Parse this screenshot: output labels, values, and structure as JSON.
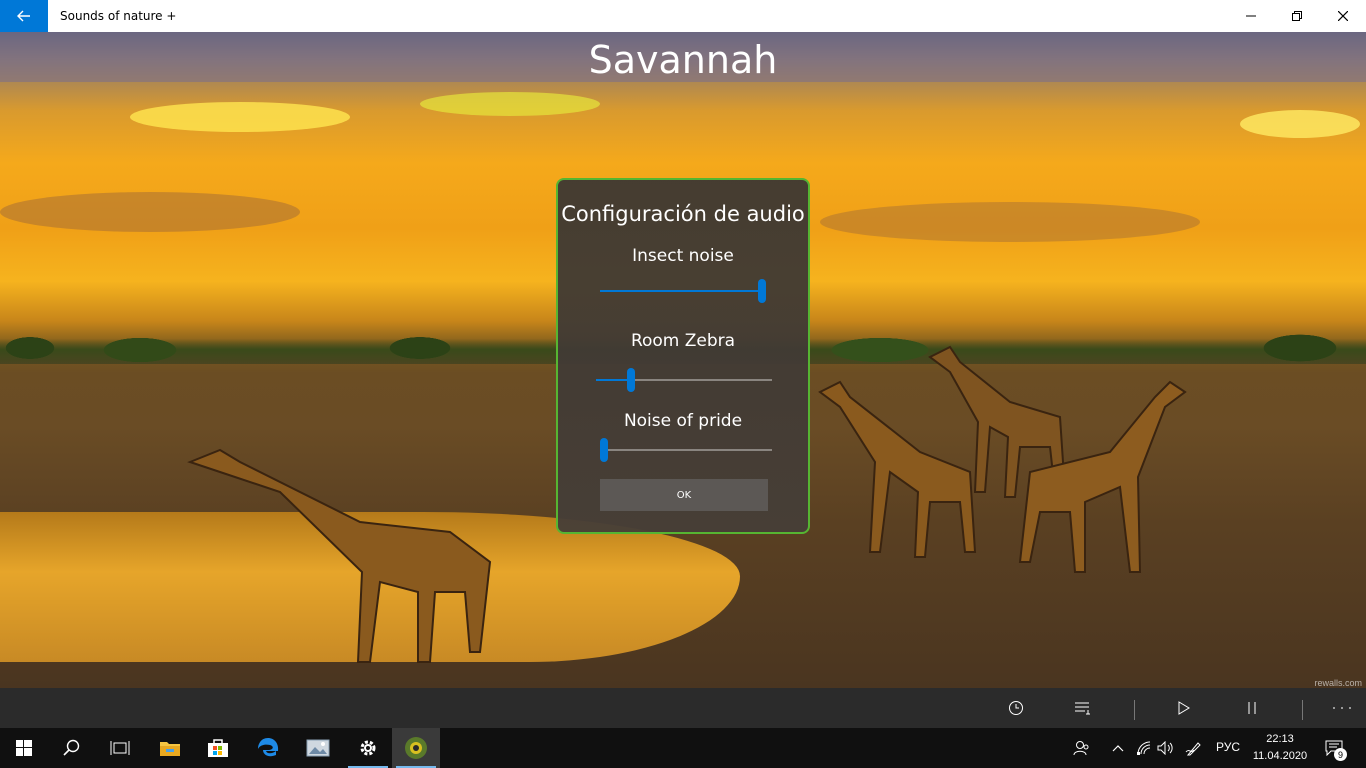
{
  "window": {
    "title": "Sounds of nature +",
    "back_icon": "arrow-left-icon",
    "minimize_icon": "minimize-icon",
    "restore_icon": "restore-icon",
    "close_icon": "close-icon"
  },
  "scene": {
    "title": "Savannah",
    "watermark": "rewalls.com"
  },
  "dialog": {
    "title": "Configuración de audio",
    "sliders": [
      {
        "label": "Insect noise",
        "value": 1.0
      },
      {
        "label": "Room Zebra",
        "value": 0.2
      },
      {
        "label": "Noise of pride",
        "value": 0.0
      }
    ],
    "ok_label": "OK",
    "accent_color": "#0078d7",
    "border_color": "#56b532"
  },
  "command_bar": {
    "buttons": [
      "timer-icon",
      "playlist-icon",
      "play-icon",
      "pause-icon",
      "more-icon"
    ]
  },
  "taskbar": {
    "apps": [
      "windows-start-icon",
      "search-icon",
      "task-view-icon",
      "file-explorer-icon",
      "store-icon",
      "edge-icon",
      "photos-icon",
      "settings-icon",
      "sounds-of-nature-icon"
    ],
    "tray": [
      "people-icon",
      "chevron-up-icon",
      "network-icon",
      "volume-icon",
      "pen-icon"
    ],
    "language": "РУС",
    "time": "22:13",
    "date": "11.04.2020",
    "notification_count": "9"
  }
}
